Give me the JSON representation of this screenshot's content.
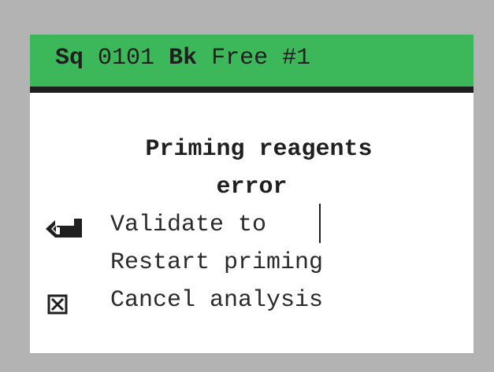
{
  "header": {
    "sq_label": "Sq",
    "sq_value": "0101",
    "bk_label": "Bk",
    "bk_value": "Free #1"
  },
  "message": {
    "title_line1": "Priming reagents",
    "title_line2": "error"
  },
  "options": [
    {
      "label": "Validate to",
      "icon": "enter-key-icon"
    },
    {
      "label": "Restart priming",
      "icon": ""
    },
    {
      "label": "Cancel analysis",
      "icon": "cancel-box-icon"
    }
  ],
  "colors": {
    "background": "#b3b3b3",
    "screen": "#ffffff",
    "header": "#3cb75a",
    "rule": "#1f1f1f",
    "text": "#1f1f1f"
  }
}
